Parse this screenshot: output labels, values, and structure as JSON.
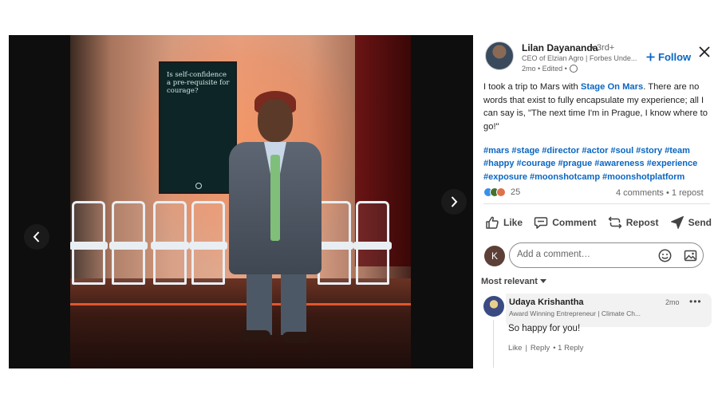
{
  "post": {
    "author_name": "Lilan Dayananda",
    "degree": "• 3rd+",
    "headline": "CEO of Elzian Agro | Forbes Unde...",
    "meta": "2mo • Edited •",
    "follow_label": "Follow",
    "body_prefix": "I took a trip to Mars with ",
    "mention": "Stage On Mars",
    "body_suffix": ". There are no words that exist to fully encapsulate my experience; all I can say is, \"The next time I'm in Prague, I know where to go!\"",
    "hashtags": [
      "#mars",
      "#stage",
      "#director",
      "#actor",
      "#soul",
      "#story",
      "#team",
      "#happy",
      "#courage",
      "#prague",
      "#awareness",
      "#experience",
      "#exposure",
      "#moonshotcamp",
      "#moonshotplatform"
    ],
    "reaction_count": "25",
    "comments_count": "4 comments",
    "stats_sep": " • ",
    "reposts_count": "1 repost"
  },
  "photo": {
    "screen_text": "Is self-confidence a pre-requisite for courage?"
  },
  "actions": {
    "like": "Like",
    "comment": "Comment",
    "repost": "Repost",
    "send": "Send"
  },
  "comment_box": {
    "avatar_initial": "K",
    "placeholder": "Add a comment…"
  },
  "sort_label": "Most relevant",
  "comment": {
    "name": "Udaya Krishantha",
    "headline": "Award Winning Entrepreneur | Climate Ch...",
    "time": "2mo",
    "more": "•••",
    "text": "So happy for you!",
    "like": "Like",
    "reply": "Reply",
    "reply_count": "• 1 Reply"
  },
  "colors": {
    "accent": "#0a66c2",
    "viewer_bg": "#0e0e0e",
    "muted_text": "#666666"
  },
  "icons": {
    "prev": "chevron-left-icon",
    "next": "chevron-right-icon",
    "close": "close-icon",
    "visibility": "globe-icon",
    "like": "thumbs-up-icon",
    "comment": "speech-bubble-icon",
    "repost": "repost-arrows-icon",
    "send": "paper-plane-icon",
    "emoji": "smiley-icon",
    "image": "image-icon",
    "sort": "caret-down-icon"
  }
}
